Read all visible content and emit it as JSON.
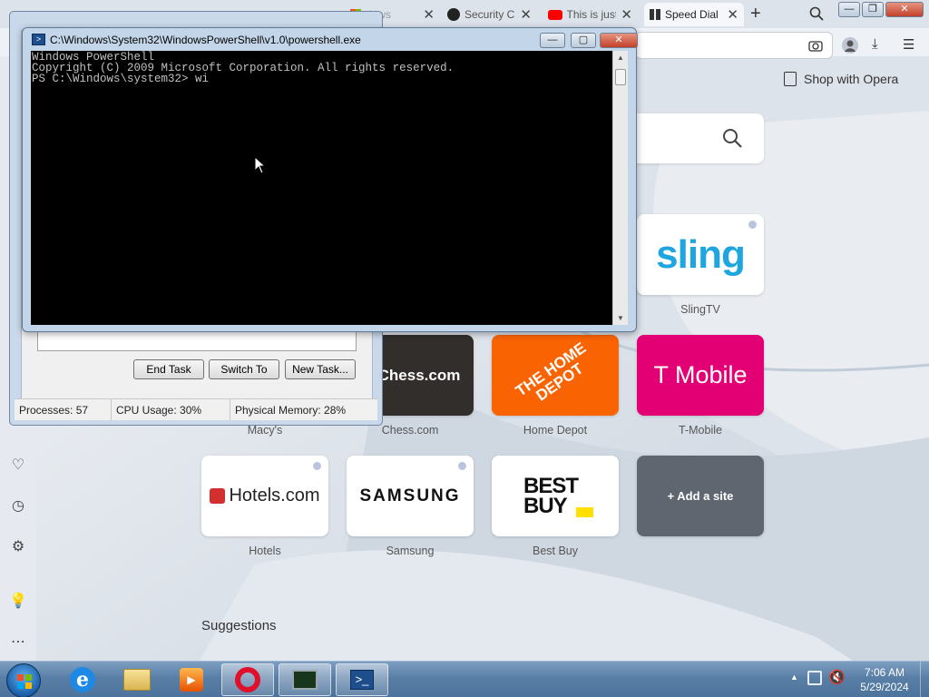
{
  "opera": {
    "tabs": [
      {
        "label": "dows",
        "icon": "windows-logo-icon"
      },
      {
        "label": "Security C",
        "icon": "github-icon"
      },
      {
        "label": "This is just",
        "icon": "youtube-icon"
      },
      {
        "label": "Speed Dial",
        "icon": "speed-dial-icon"
      }
    ],
    "close_glyph": "✕",
    "new_tab_glyph": "+",
    "shop_label": "Shop with Opera",
    "tiles": [
      {
        "label": "SlingTV",
        "logo": "sling"
      },
      {
        "label": "Macy's",
        "logo": ""
      },
      {
        "label": "Chess.com",
        "logo": "Chess.com"
      },
      {
        "label": "Home Depot",
        "logo": "THE HOME DEPOT"
      },
      {
        "label": "T-Mobile",
        "logo": "T Mobile"
      },
      {
        "label": "Hotels",
        "logo": "Hotels.com"
      },
      {
        "label": "Samsung",
        "logo": "SAMSUNG"
      },
      {
        "label": "Best Buy",
        "logo": "BEST BUY"
      },
      {
        "label": "",
        "logo": "+ Add a site"
      }
    ],
    "suggestions_label": "Suggestions",
    "colors": {
      "chess": "#312e2b",
      "home_depot": "#f96302",
      "tmobile": "#e20074",
      "sling": "#1fa5df",
      "add_site": "#5f6670"
    }
  },
  "taskmgr": {
    "buttons": [
      "End Task",
      "Switch To",
      "New Task..."
    ],
    "status": {
      "processes": "Processes: 57",
      "cpu": "CPU Usage: 30%",
      "memory": "Physical Memory: 28%"
    }
  },
  "powershell": {
    "title": "C:\\Windows\\System32\\WindowsPowerShell\\v1.0\\powershell.exe",
    "lines": [
      "Windows PowerShell",
      "Copyright (C) 2009 Microsoft Corporation. All rights reserved.",
      "",
      "PS C:\\Windows\\system32> wi"
    ],
    "buttons": {
      "minimize": "—",
      "maximize": "▢",
      "close": "✕"
    }
  },
  "taskbar": {
    "apps": [
      "ie-icon",
      "explorer-folder-icon",
      "media-player-icon",
      "opera-icon",
      "task-manager-icon",
      "powershell-icon"
    ],
    "time": "7:06 AM",
    "date": "5/29/2024"
  }
}
